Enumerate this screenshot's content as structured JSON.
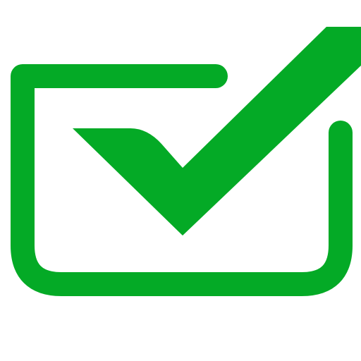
{
  "icon": {
    "name": "checkbox-checked-icon",
    "color": "#04AA26",
    "background": "#FFFFFF"
  }
}
